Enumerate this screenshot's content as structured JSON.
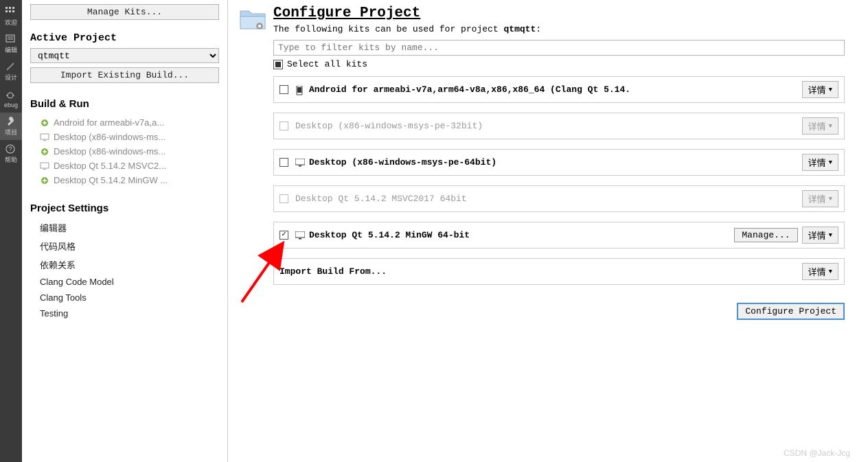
{
  "iconbar": {
    "items": [
      {
        "label": "欢迎",
        "name": "welcome"
      },
      {
        "label": "编辑",
        "name": "edit"
      },
      {
        "label": "设计",
        "name": "design"
      },
      {
        "label": "ebug",
        "name": "debug"
      },
      {
        "label": "项目",
        "name": "projects",
        "active": true
      },
      {
        "label": "帮助",
        "name": "help"
      }
    ]
  },
  "left": {
    "manage_kits": "Manage Kits...",
    "active_project_title": "Active Project",
    "active_project": "qtmqtt",
    "import_existing": "Import Existing Build...",
    "build_run_title": "Build & Run",
    "kits": [
      {
        "icon": "plus",
        "label": "Android for armeabi-v7a,a..."
      },
      {
        "icon": "desktop",
        "label": "Desktop (x86-windows-ms..."
      },
      {
        "icon": "plus",
        "label": "Desktop (x86-windows-ms..."
      },
      {
        "icon": "desktop",
        "label": "Desktop Qt 5.14.2 MSVC2..."
      },
      {
        "icon": "plus",
        "label": "Desktop Qt 5.14.2 MinGW ..."
      }
    ],
    "project_settings_title": "Project Settings",
    "settings": [
      "编辑器",
      "代码风格",
      "依赖关系",
      "Clang Code Model",
      "Clang Tools",
      "Testing"
    ]
  },
  "main": {
    "title": "Configure Project",
    "subtitle_pre": "The following kits can be used for project ",
    "subtitle_name": "qtmqtt",
    "subtitle_post": ":",
    "filter_placeholder": "Type to filter kits by name...",
    "select_all": "Select all kits",
    "kits": [
      {
        "checked": false,
        "disabled": false,
        "icon": "phone",
        "label": "Android for armeabi-v7a,arm64-v8a,x86,x86_64 (Clang Qt 5.14.",
        "details": "详情"
      },
      {
        "checked": false,
        "disabled": true,
        "icon": "desktop",
        "label": "Desktop (x86-windows-msys-pe-32bit)",
        "details": "详情"
      },
      {
        "checked": false,
        "disabled": false,
        "icon": "desktop",
        "label": "Desktop (x86-windows-msys-pe-64bit)",
        "details": "详情"
      },
      {
        "checked": false,
        "disabled": true,
        "icon": "none",
        "label": "Desktop Qt 5.14.2 MSVC2017 64bit",
        "details": "详情"
      },
      {
        "checked": true,
        "disabled": false,
        "icon": "desktop",
        "label": "Desktop Qt 5.14.2 MinGW 64-bit",
        "details": "详情",
        "manage": "Manage..."
      }
    ],
    "import_build": "Import Build From...",
    "import_details": "详情",
    "configure_button": "Configure Project"
  },
  "watermark": "CSDN @Jack-Jcg"
}
